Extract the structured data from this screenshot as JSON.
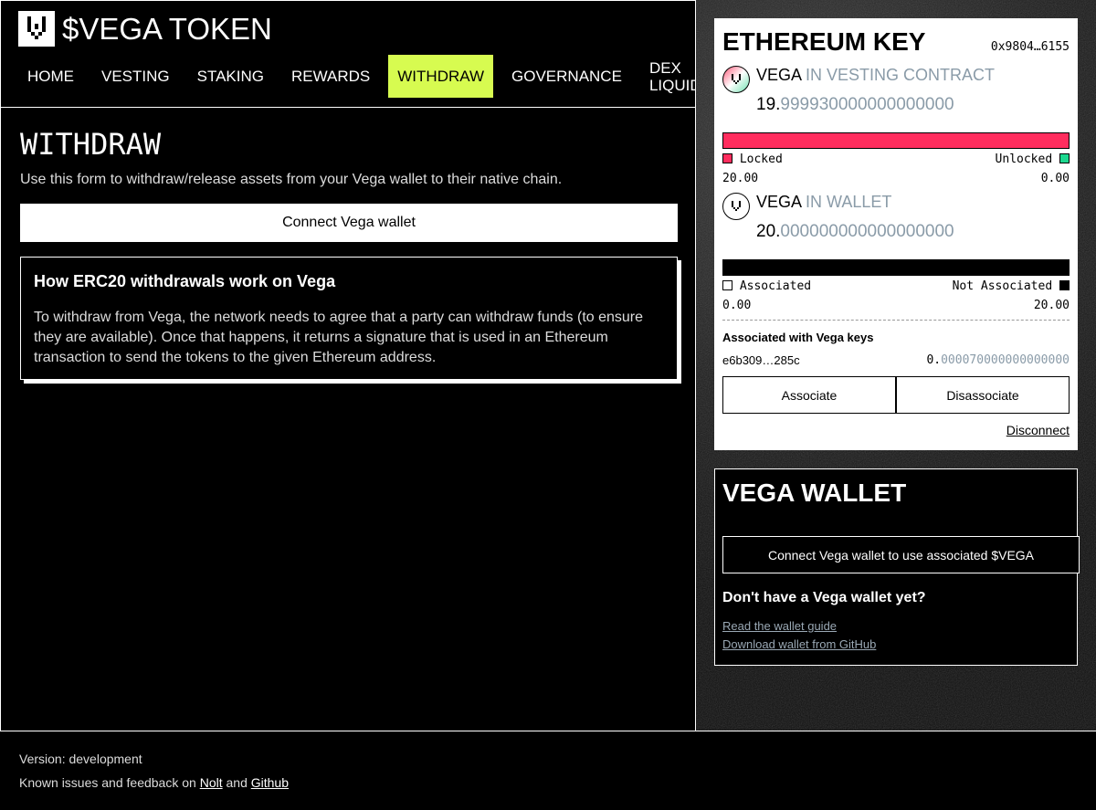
{
  "app": {
    "title": "$VEGA TOKEN"
  },
  "nav": {
    "items": [
      {
        "label": "HOME"
      },
      {
        "label": "VESTING"
      },
      {
        "label": "STAKING"
      },
      {
        "label": "REWARDS"
      },
      {
        "label": "WITHDRAW",
        "active": true
      },
      {
        "label": "GOVERNANCE"
      },
      {
        "label_line1": "DEX",
        "label_line2": "LIQUIDITY"
      }
    ]
  },
  "main": {
    "title": "WITHDRAW",
    "description": "Use this form to withdraw/release assets from your Vega wallet to their native chain.",
    "connect_label": "Connect Vega wallet",
    "info": {
      "title": "How ERC20 withdrawals work on Vega",
      "text": "To withdraw from Vega, the network needs to agree that a party can withdraw funds (to ensure they are available). Once that happens, it returns a signature that is used in an Ethereum transaction to send the tokens to the given Ethereum address."
    }
  },
  "eth_key": {
    "title": "ETHEREUM KEY",
    "address": "0x9804…6155",
    "vesting": {
      "token": "VEGA",
      "context": "IN VESTING CONTRACT",
      "amount_int": "19.",
      "amount_dec": "999930000000000000",
      "locked_label": "Locked",
      "unlocked_label": "Unlocked",
      "locked_value": "20.00",
      "unlocked_value": "0.00",
      "locked_color": "#ff2d5e",
      "unlocked_color": "#1dd88f"
    },
    "wallet": {
      "token": "VEGA",
      "context": "IN WALLET",
      "amount_int": "20.",
      "amount_dec": "000000000000000000",
      "associated_label": "Associated",
      "not_associated_label": "Not Associated",
      "associated_value": "0.00",
      "not_associated_value": "20.00"
    },
    "associated_title": "Associated with Vega keys",
    "associated_key": "e6b309…285c",
    "associated_amount_int": "0.",
    "associated_amount_dec": "000070000000000000",
    "associate_label": "Associate",
    "disassociate_label": "Disassociate",
    "disconnect_label": "Disconnect"
  },
  "vega_wallet": {
    "title": "VEGA WALLET",
    "connect_label": "Connect Vega wallet to use associated $VEGA",
    "no_wallet": "Don't have a Vega wallet yet?",
    "guide_link": "Read the wallet guide",
    "download_link": "Download wallet from GitHub"
  },
  "footer": {
    "version": "Version: development",
    "feedback_prefix": "Known issues and feedback on",
    "nolt": "Nolt",
    "and": "and",
    "github": "Github"
  },
  "colors": {
    "accent": "#d7fb50",
    "muted": "#8a9ba8"
  }
}
